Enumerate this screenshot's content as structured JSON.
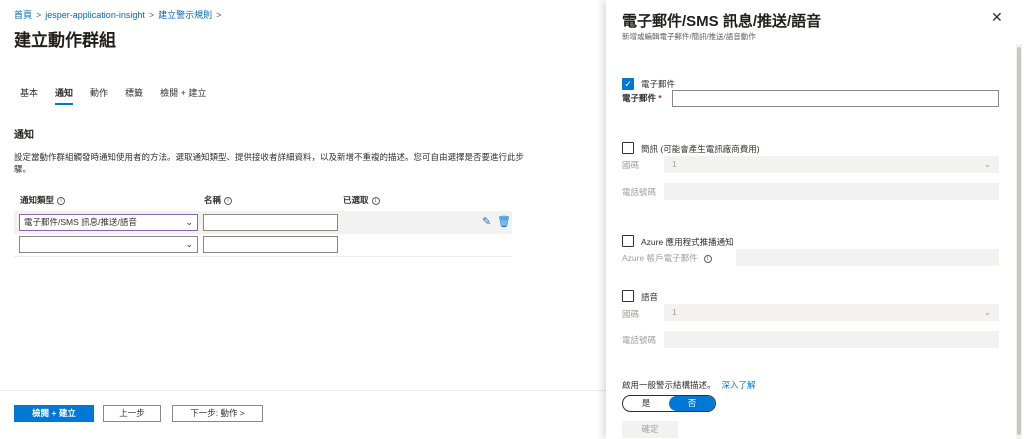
{
  "breadcrumb": [
    "首頁",
    "jesper-application-insight",
    "建立警示規則"
  ],
  "page_title": "建立動作群組",
  "tabs": [
    {
      "label": "基本",
      "active": false
    },
    {
      "label": "通知",
      "active": true
    },
    {
      "label": "動作",
      "active": false
    },
    {
      "label": "標籤",
      "active": false
    },
    {
      "label": "檢閱 + 建立",
      "active": false
    }
  ],
  "notifications": {
    "section_title": "通知",
    "description": "設定當動作群組觸發時通知使用者的方法。選取通知類型、提供接收者詳細資料，以及新增不重複的描述。您可自由選擇是否要進行此步驟。",
    "col_type": "通知類型",
    "col_name": "名稱",
    "col_selected": "已選取",
    "row1_type": "電子郵件/SMS 訊息/推送/語音",
    "row1_name": "",
    "row2_type": "",
    "row2_name": ""
  },
  "footer": {
    "review_create": "檢閱 + 建立",
    "previous": "上一步",
    "next": "下一步: 動作 >"
  },
  "panel": {
    "title": "電子郵件/SMS 訊息/推送/語音",
    "subtitle": "新增或編輯電子郵件/簡訊/推送/語音動作",
    "email_checkbox": "電子郵件",
    "email_checked": true,
    "email_field_label": "電子郵件",
    "email_value": "",
    "sms_checkbox": "簡訊 (可能會產生電訊廠商費用)",
    "sms_country_label": "國碼",
    "sms_country_value": "1",
    "sms_phone_label": "電話號碼",
    "push_checkbox": "Azure 應用程式推播通知",
    "push_account_label": "Azure 帳戶電子郵件",
    "voice_checkbox": "語音",
    "voice_country_label": "國碼",
    "voice_country_value": "1",
    "voice_phone_label": "電話號碼",
    "common_schema_label": "啟用一般警示結構描述。",
    "learn_more": "深入了解",
    "toggle_yes": "是",
    "toggle_no": "否",
    "toggle_selected": "否",
    "confirm": "確定"
  },
  "colors": {
    "accent": "#0078d4",
    "link": "#0067b8",
    "focus_border": "#8764b8",
    "disabled_bg": "#f3f2f1"
  },
  "icons": [
    "chevron-right-icon",
    "info-icon",
    "chevron-down-icon",
    "edit-icon",
    "delete-icon",
    "close-icon",
    "checkmark-icon"
  ]
}
